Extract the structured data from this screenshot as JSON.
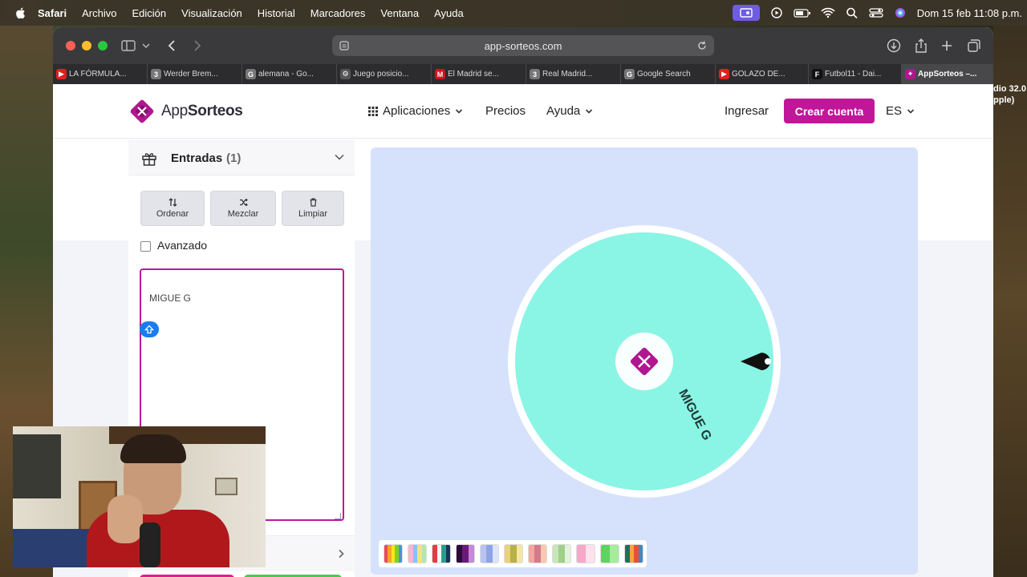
{
  "menubar": {
    "items": [
      "Safari",
      "Archivo",
      "Edición",
      "Visualización",
      "Historial",
      "Marcadores",
      "Ventana",
      "Ayuda"
    ],
    "clock": "Dom 15 feb 11:08 p.m."
  },
  "desktop": {
    "right_text_1": "dio 32.0",
    "right_text_2": "pple)"
  },
  "browser": {
    "url": "app-sorteos.com",
    "tabs": [
      {
        "label": "LA FÓRMULA...",
        "fav": "▶",
        "color": "#e02020"
      },
      {
        "label": "Werder Brem...",
        "fav": "3",
        "color": "#777777"
      },
      {
        "label": "alemana - Go...",
        "fav": "G",
        "color": "#777777"
      },
      {
        "label": "Juego posicio...",
        "fav": "⚙",
        "color": "#555555"
      },
      {
        "label": "El Madrid se...",
        "fav": "M",
        "color": "#d0141a"
      },
      {
        "label": "Real Madrid...",
        "fav": "3",
        "color": "#777777"
      },
      {
        "label": "Google Search",
        "fav": "G",
        "color": "#777777"
      },
      {
        "label": "GOLAZO DE...",
        "fav": "▶",
        "color": "#e02020"
      },
      {
        "label": "Futbol11 - Dai...",
        "fav": "F",
        "color": "#111111"
      },
      {
        "label": "AppSorteos –...",
        "fav": "✦",
        "color": "#b0178e"
      }
    ]
  },
  "site": {
    "logo_light": "App",
    "logo_bold": "Sorteos",
    "nav": {
      "apps": "Aplicaciones",
      "prices": "Precios",
      "help": "Ayuda",
      "login": "Ingresar",
      "signup": "Crear cuenta",
      "lang": "ES"
    },
    "panel": {
      "title": "Entradas",
      "count": "(1)",
      "buttons": {
        "sort": "Ordenar",
        "shuffle": "Mezclar",
        "clear": "Limpiar"
      },
      "advanced": "Avanzado",
      "entries": "MIGUE G"
    },
    "wheel": {
      "segments": [
        "MIGUE G"
      ],
      "segment_color": "#8af5e4"
    },
    "brand_color": "#c0179a"
  }
}
